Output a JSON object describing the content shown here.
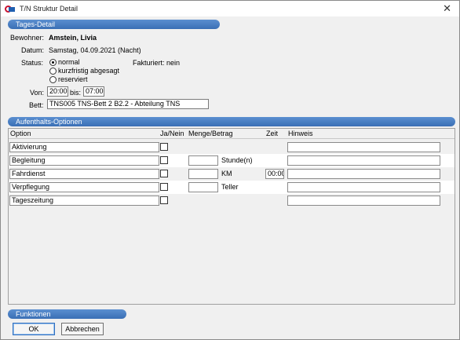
{
  "window": {
    "title": "T/N Struktur Detail",
    "close_glyph": "✕"
  },
  "sections": {
    "tages_detail": "Tages-Detail",
    "aufenthalts": "Aufenthalts-Optionen",
    "funktionen": "Funktionen"
  },
  "detail": {
    "bewohner_label": "Bewohner:",
    "bewohner_value": "Amstein, Livia",
    "datum_label": "Datum:",
    "datum_value": "Samstag, 04.09.2021 (Nacht)",
    "status_label": "Status:",
    "status_options": [
      "normal",
      "kurzfristig abgesagt",
      "reserviert"
    ],
    "status_selected": "normal",
    "fakturiert": "Fakturiert: nein",
    "von_label": "Von:",
    "von_value": "20:00",
    "bis_label": "bis:",
    "bis_value": "07:00",
    "bett_label": "Bett:",
    "bett_value": "TNS005 TNS-Bett 2     B2.2 - Abteilung TNS"
  },
  "grid": {
    "headers": [
      "Option",
      "Ja/Nein",
      "Menge/Betrag",
      "Zeit",
      "Hinweis"
    ],
    "rows": [
      {
        "option": "Aktivierung",
        "checked": false,
        "menge": "",
        "unit": "",
        "zeit": "",
        "hinweis": ""
      },
      {
        "option": "Begleitung",
        "checked": false,
        "menge": "",
        "unit": "Stunde(n)",
        "zeit": "",
        "hinweis": ""
      },
      {
        "option": "Fahrdienst",
        "checked": false,
        "menge": "",
        "unit": "KM",
        "zeit": "00:00",
        "hinweis": ""
      },
      {
        "option": "Verpflegung",
        "checked": false,
        "menge": "",
        "unit": "Teller",
        "zeit": "",
        "hinweis": ""
      },
      {
        "option": "Tageszeitung",
        "checked": false,
        "menge": "",
        "unit": "",
        "zeit": "",
        "hinweis": ""
      }
    ]
  },
  "buttons": {
    "ok": "OK",
    "abbrechen": "Abbrechen"
  }
}
